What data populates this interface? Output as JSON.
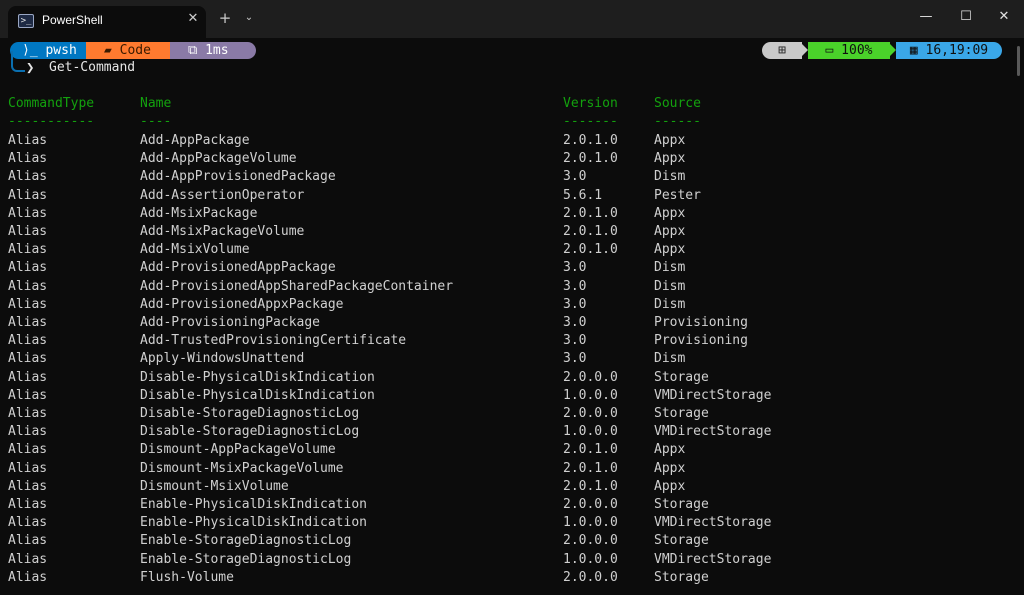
{
  "window": {
    "tab_title": "PowerShell",
    "tab_icon": "powershell-icon",
    "new_tab_label": "+",
    "dropdown_label": "⌄",
    "close_tab_label": "✕",
    "minimize_label": "—",
    "maximize_label": "☐",
    "close_label": "✕"
  },
  "prompt": {
    "shell": "⟩_ pwsh",
    "path": "▰ Code",
    "duration": "⧉ 1ms",
    "os": "⊞",
    "battery": "▭ 100%",
    "clock": "▦ 16,19:09",
    "arrow": "❯",
    "command": "Get-Command"
  },
  "colors": {
    "shell_segment": "#0077c2",
    "path_segment": "#ff7a2f",
    "time_segment": "#8a7aa6",
    "os_segment": "#c9c9c9",
    "battery_segment": "#4ad22a",
    "clock_segment": "#3aa7e8",
    "header_text": "#13a10e"
  },
  "table": {
    "headers": [
      "CommandType",
      "Name",
      "Version",
      "Source"
    ],
    "separators": [
      "-----------",
      "----",
      "-------",
      "------"
    ],
    "rows": [
      [
        "Alias",
        "Add-AppPackage",
        "2.0.1.0",
        "Appx"
      ],
      [
        "Alias",
        "Add-AppPackageVolume",
        "2.0.1.0",
        "Appx"
      ],
      [
        "Alias",
        "Add-AppProvisionedPackage",
        "3.0",
        "Dism"
      ],
      [
        "Alias",
        "Add-AssertionOperator",
        "5.6.1",
        "Pester"
      ],
      [
        "Alias",
        "Add-MsixPackage",
        "2.0.1.0",
        "Appx"
      ],
      [
        "Alias",
        "Add-MsixPackageVolume",
        "2.0.1.0",
        "Appx"
      ],
      [
        "Alias",
        "Add-MsixVolume",
        "2.0.1.0",
        "Appx"
      ],
      [
        "Alias",
        "Add-ProvisionedAppPackage",
        "3.0",
        "Dism"
      ],
      [
        "Alias",
        "Add-ProvisionedAppSharedPackageContainer",
        "3.0",
        "Dism"
      ],
      [
        "Alias",
        "Add-ProvisionedAppxPackage",
        "3.0",
        "Dism"
      ],
      [
        "Alias",
        "Add-ProvisioningPackage",
        "3.0",
        "Provisioning"
      ],
      [
        "Alias",
        "Add-TrustedProvisioningCertificate",
        "3.0",
        "Provisioning"
      ],
      [
        "Alias",
        "Apply-WindowsUnattend",
        "3.0",
        "Dism"
      ],
      [
        "Alias",
        "Disable-PhysicalDiskIndication",
        "2.0.0.0",
        "Storage"
      ],
      [
        "Alias",
        "Disable-PhysicalDiskIndication",
        "1.0.0.0",
        "VMDirectStorage"
      ],
      [
        "Alias",
        "Disable-StorageDiagnosticLog",
        "2.0.0.0",
        "Storage"
      ],
      [
        "Alias",
        "Disable-StorageDiagnosticLog",
        "1.0.0.0",
        "VMDirectStorage"
      ],
      [
        "Alias",
        "Dismount-AppPackageVolume",
        "2.0.1.0",
        "Appx"
      ],
      [
        "Alias",
        "Dismount-MsixPackageVolume",
        "2.0.1.0",
        "Appx"
      ],
      [
        "Alias",
        "Dismount-MsixVolume",
        "2.0.1.0",
        "Appx"
      ],
      [
        "Alias",
        "Enable-PhysicalDiskIndication",
        "2.0.0.0",
        "Storage"
      ],
      [
        "Alias",
        "Enable-PhysicalDiskIndication",
        "1.0.0.0",
        "VMDirectStorage"
      ],
      [
        "Alias",
        "Enable-StorageDiagnosticLog",
        "2.0.0.0",
        "Storage"
      ],
      [
        "Alias",
        "Enable-StorageDiagnosticLog",
        "1.0.0.0",
        "VMDirectStorage"
      ],
      [
        "Alias",
        "Flush-Volume",
        "2.0.0.0",
        "Storage"
      ]
    ]
  }
}
